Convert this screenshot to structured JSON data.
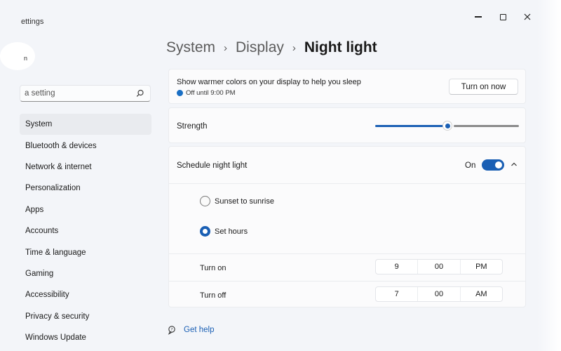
{
  "window": {
    "title": "ettings"
  },
  "sidebar": {
    "avatar_glyph": "n",
    "search": {
      "placeholder": "a setting"
    },
    "items": [
      {
        "label": "System",
        "active": true
      },
      {
        "label": "Bluetooth & devices"
      },
      {
        "label": "Network & internet"
      },
      {
        "label": "Personalization"
      },
      {
        "label": "Apps"
      },
      {
        "label": "Accounts"
      },
      {
        "label": "Time & language"
      },
      {
        "label": "Gaming"
      },
      {
        "label": "Accessibility"
      },
      {
        "label": "Privacy & security"
      },
      {
        "label": "Windows Update"
      }
    ]
  },
  "breadcrumb": [
    "System",
    "Display",
    "Night light"
  ],
  "warm_colors": {
    "title": "Show warmer colors on your display to help you sleep",
    "status": "Off until 9:00 PM",
    "button": "Turn on now"
  },
  "strength": {
    "label": "Strength",
    "value_fraction": 0.5
  },
  "schedule": {
    "title": "Schedule night light",
    "toggle_state": "On",
    "options": [
      {
        "label": "Sunset to sunrise",
        "selected": false
      },
      {
        "label": "Set hours",
        "selected": true
      }
    ],
    "turn_on": {
      "label": "Turn on",
      "hour": "9",
      "minute": "00",
      "period": "PM"
    },
    "turn_off": {
      "label": "Turn off",
      "hour": "7",
      "minute": "00",
      "period": "AM"
    }
  },
  "help": {
    "label": "Get help"
  },
  "colors": {
    "accent": "#1a5fb4",
    "window_bg": "#f3f5f9",
    "card_bg": "#fbfbfc"
  }
}
